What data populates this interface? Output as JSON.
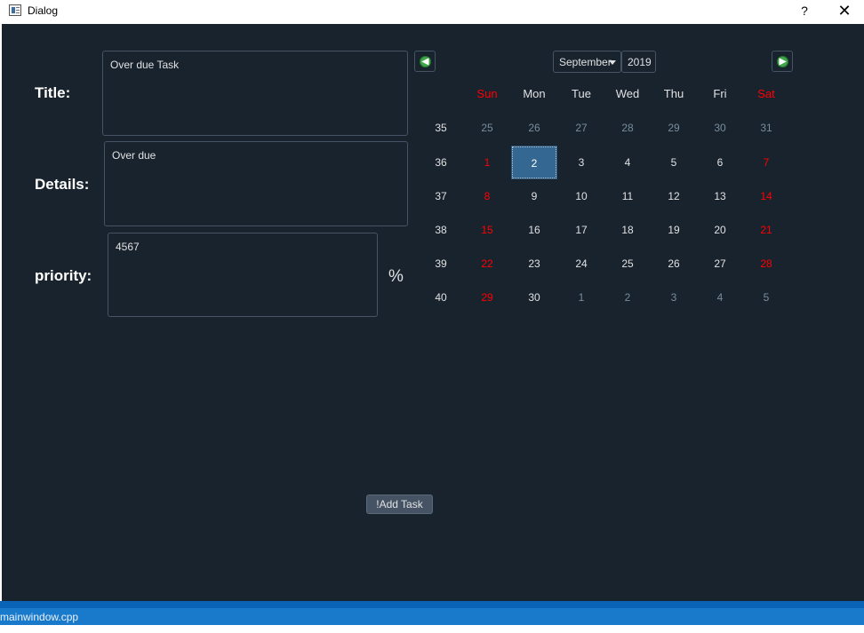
{
  "window": {
    "title": "Dialog",
    "help_label": "?",
    "close_label": "✕"
  },
  "form": {
    "title_label": "Title:",
    "title_value": "Over due Task",
    "details_label": "Details:",
    "details_value": "Over due",
    "priority_label": "priority:",
    "priority_value": "4567",
    "percent_label": "%"
  },
  "calendar": {
    "month": "September",
    "year": "2019",
    "prev_icon": "arrow-left-icon",
    "next_icon": "arrow-right-icon",
    "day_headers": [
      "Sun",
      "Mon",
      "Tue",
      "Wed",
      "Thu",
      "Fri",
      "Sat"
    ],
    "weeks": [
      {
        "num": "35",
        "days": [
          "25",
          "26",
          "27",
          "28",
          "29",
          "30",
          "31"
        ]
      },
      {
        "num": "36",
        "days": [
          "1",
          "2",
          "3",
          "4",
          "5",
          "6",
          "7"
        ]
      },
      {
        "num": "37",
        "days": [
          "8",
          "9",
          "10",
          "11",
          "12",
          "13",
          "14"
        ]
      },
      {
        "num": "38",
        "days": [
          "15",
          "16",
          "17",
          "18",
          "19",
          "20",
          "21"
        ]
      },
      {
        "num": "39",
        "days": [
          "22",
          "23",
          "24",
          "25",
          "26",
          "27",
          "28"
        ]
      },
      {
        "num": "40",
        "days": [
          "29",
          "30",
          "1",
          "2",
          "3",
          "4",
          "5"
        ]
      }
    ],
    "selected_day": "2",
    "colors": {
      "weekend": "#ff0000",
      "selected": "#346792",
      "other_month": "#788d9c"
    }
  },
  "actions": {
    "add_task_label": "!Add Task"
  },
  "taskbar": {
    "label": "mainwindow.cpp"
  },
  "theme": {
    "background": "#19232d",
    "border": "#455364",
    "accent": "#1979ca"
  }
}
